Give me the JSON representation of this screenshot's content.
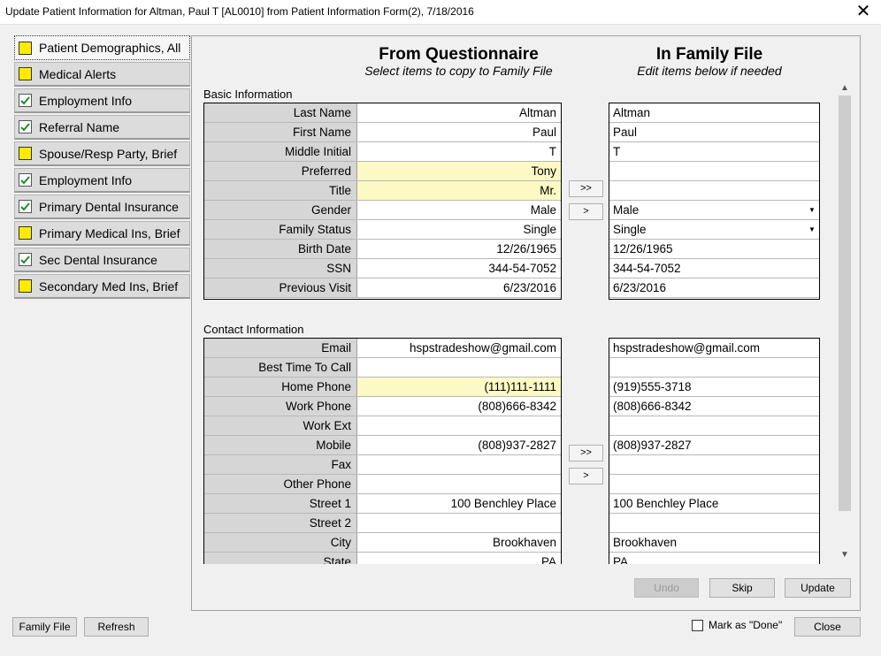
{
  "window": {
    "title": "Update Patient Information for Altman, Paul T [AL0010] from Patient Information Form(2), 7/18/2016",
    "close_label": "✕"
  },
  "nav": [
    {
      "label": "Patient Demographics, All",
      "state": "yellow"
    },
    {
      "label": "Medical Alerts",
      "state": "yellow"
    },
    {
      "label": "Employment Info",
      "state": "checked"
    },
    {
      "label": "Referral Name",
      "state": "checked"
    },
    {
      "label": "Spouse/Resp Party, Brief",
      "state": "yellow"
    },
    {
      "label": "Employment Info",
      "state": "checked"
    },
    {
      "label": "Primary Dental Insurance",
      "state": "checked"
    },
    {
      "label": "Primary Medical Ins, Brief",
      "state": "yellow"
    },
    {
      "label": "Sec Dental Insurance",
      "state": "checked"
    },
    {
      "label": "Secondary Med Ins, Brief",
      "state": "yellow"
    }
  ],
  "headers": {
    "from_title": "From Questionnaire",
    "from_sub": "Select items to copy to Family File",
    "to_title": "In Family File",
    "to_sub": "Edit items below if needed"
  },
  "basic": {
    "label": "Basic Information",
    "rows": [
      {
        "label": "Last Name",
        "from": "Altman",
        "to": "Altman"
      },
      {
        "label": "First Name",
        "from": "Paul",
        "to": "Paul"
      },
      {
        "label": "Middle Initial",
        "from": "T",
        "to": "T"
      },
      {
        "label": "Preferred",
        "from": "Tony",
        "to": "",
        "highlight": true
      },
      {
        "label": "Title",
        "from": "Mr.",
        "to": "",
        "highlight": true
      },
      {
        "label": "Gender",
        "from": "Male",
        "to": "Male",
        "dropdown": true
      },
      {
        "label": "Family Status",
        "from": "Single",
        "to": "Single",
        "dropdown": true
      },
      {
        "label": "Birth Date",
        "from": "12/26/1965",
        "to": "12/26/1965"
      },
      {
        "label": "SSN",
        "from": "344-54-7052",
        "to": "344-54-7052"
      },
      {
        "label": "Previous Visit",
        "from": "6/23/2016",
        "to": "6/23/2016"
      }
    ]
  },
  "contact": {
    "label": "Contact Information",
    "rows": [
      {
        "label": "Email",
        "from": "hspstradeshow@gmail.com",
        "to": "hspstradeshow@gmail.com"
      },
      {
        "label": "Best Time To Call",
        "from": "",
        "to": ""
      },
      {
        "label": "Home Phone",
        "from": "(111)111-1111",
        "to": "(919)555-3718",
        "highlight": true
      },
      {
        "label": "Work Phone",
        "from": "(808)666-8342",
        "to": "(808)666-8342"
      },
      {
        "label": "Work Ext",
        "from": "",
        "to": ""
      },
      {
        "label": "Mobile",
        "from": "(808)937-2827",
        "to": "(808)937-2827"
      },
      {
        "label": "Fax",
        "from": "",
        "to": ""
      },
      {
        "label": "Other Phone",
        "from": "",
        "to": ""
      },
      {
        "label": "Street 1",
        "from": "100 Benchley Place",
        "to": "100 Benchley Place"
      },
      {
        "label": "Street 2",
        "from": "",
        "to": ""
      },
      {
        "label": "City",
        "from": "Brookhaven",
        "to": "Brookhaven"
      },
      {
        "label": "State",
        "from": "PA",
        "to": "PA"
      }
    ]
  },
  "copy_buttons": {
    "all": ">>",
    "one": ">"
  },
  "actions": {
    "undo": "Undo",
    "skip": "Skip",
    "update": "Update"
  },
  "footer": {
    "family_file": "Family File",
    "refresh": "Refresh",
    "mark_done": "Mark as \"Done\"",
    "close": "Close"
  },
  "colors": {
    "highlight": "#fcf9c4",
    "yellow_box": "#ffeb00",
    "check": "#1a8f2a"
  }
}
